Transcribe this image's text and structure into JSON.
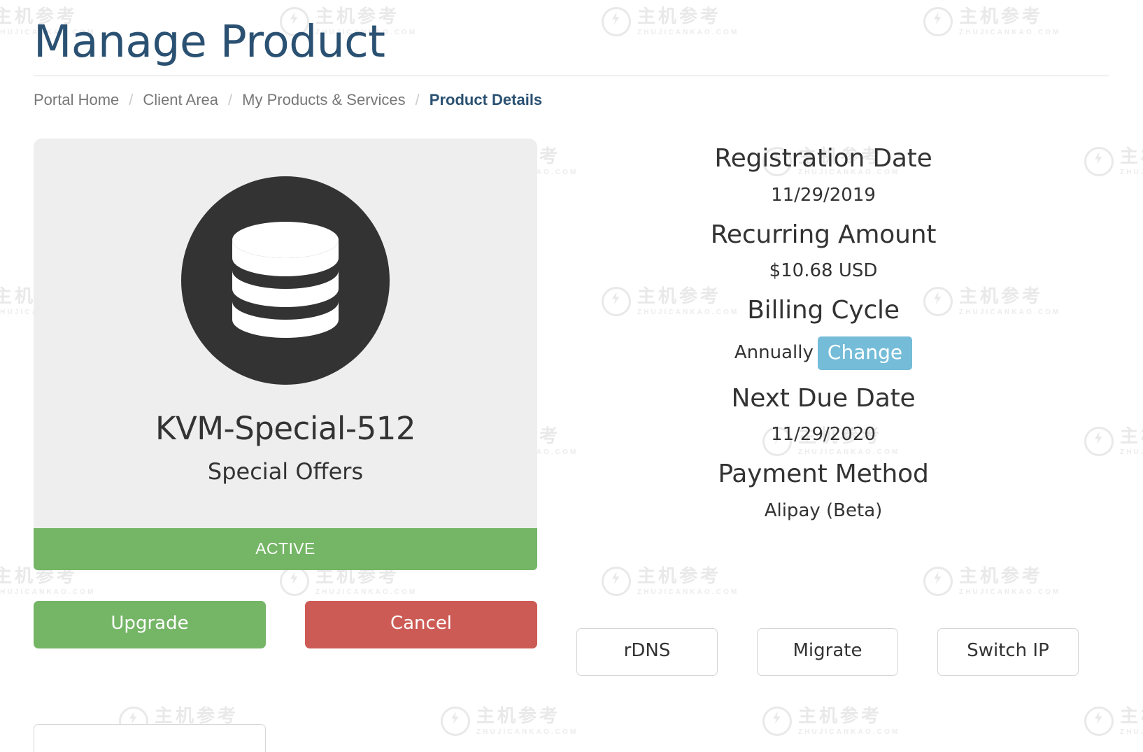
{
  "header": {
    "title": "Manage Product"
  },
  "breadcrumb": {
    "separator": "/",
    "items": [
      {
        "label": "Portal Home",
        "active": false
      },
      {
        "label": "Client Area",
        "active": false
      },
      {
        "label": "My Products & Services",
        "active": false
      },
      {
        "label": "Product Details",
        "active": true
      }
    ]
  },
  "product_card": {
    "icon": "database-icon",
    "name": "KVM-Special-512",
    "group": "Special Offers",
    "status": "ACTIVE",
    "status_color": "#74b566",
    "card_bg": "#eeeeee",
    "icon_bg": "#333333"
  },
  "details": {
    "registration_date_label": "Registration Date",
    "registration_date_value": "11/29/2019",
    "recurring_amount_label": "Recurring Amount",
    "recurring_amount_value": "$10.68 USD",
    "billing_cycle_label": "Billing Cycle",
    "billing_cycle_value": "Annually",
    "billing_cycle_change_label": "Change",
    "billing_cycle_change_color": "#74bcd8",
    "next_due_date_label": "Next Due Date",
    "next_due_date_value": "11/29/2020",
    "payment_method_label": "Payment Method",
    "payment_method_value": "Alipay (Beta)"
  },
  "actions": {
    "upgrade": "Upgrade",
    "cancel": "Cancel",
    "rdns": "rDNS",
    "migrate": "Migrate",
    "switch_ip": "Switch IP",
    "upgrade_color": "#74b566",
    "cancel_color": "#cd5b55"
  },
  "watermark": {
    "cn": "主机参考",
    "en": "ZHUJICANKAO.COM",
    "color": "#e9e9e9"
  },
  "theme": {
    "title_color": "#2b5172",
    "breadcrumb_color": "#777777",
    "breadcrumb_active_color": "#2b5172",
    "text_color": "#333333"
  }
}
